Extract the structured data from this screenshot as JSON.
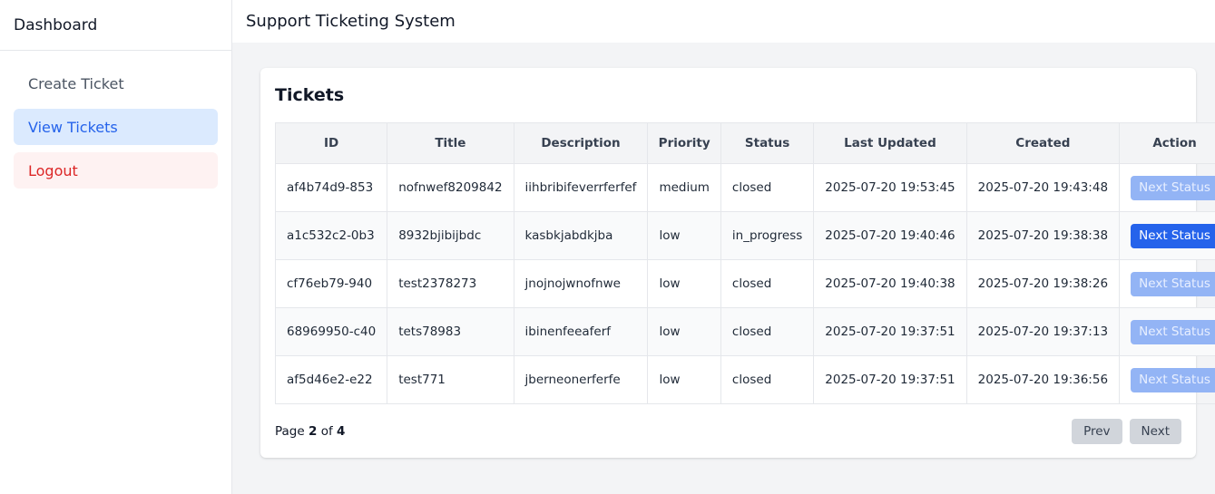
{
  "sidebar": {
    "brand": "Dashboard",
    "items": [
      {
        "label": "Create Ticket"
      },
      {
        "label": "View Tickets"
      },
      {
        "label": "Logout"
      }
    ]
  },
  "header": {
    "title": "Support Ticketing System"
  },
  "main": {
    "title": "Tickets",
    "columns": [
      "ID",
      "Title",
      "Description",
      "Priority",
      "Status",
      "Last Updated",
      "Created",
      "Action"
    ],
    "rows": [
      {
        "id": "af4b74d9-853",
        "title": "nofnwef8209842",
        "description": "iihbribifeverrferfef",
        "priority": "medium",
        "status": "closed",
        "updated": "2025-07-20 19:53:45",
        "created": "2025-07-20 19:43:48",
        "action": "Next Status",
        "action_enabled": false
      },
      {
        "id": "a1c532c2-0b3",
        "title": "8932bjibijbdc",
        "description": "kasbkjabdkjba",
        "priority": "low",
        "status": "in_progress",
        "updated": "2025-07-20 19:40:46",
        "created": "2025-07-20 19:38:38",
        "action": "Next Status",
        "action_enabled": true
      },
      {
        "id": "cf76eb79-940",
        "title": "test2378273",
        "description": "jnojnojwnofnwe",
        "priority": "low",
        "status": "closed",
        "updated": "2025-07-20 19:40:38",
        "created": "2025-07-20 19:38:26",
        "action": "Next Status",
        "action_enabled": false
      },
      {
        "id": "68969950-c40",
        "title": "tets78983",
        "description": "ibinenfeeaferf",
        "priority": "low",
        "status": "closed",
        "updated": "2025-07-20 19:37:51",
        "created": "2025-07-20 19:37:13",
        "action": "Next Status",
        "action_enabled": false
      },
      {
        "id": "af5d46e2-e22",
        "title": "test771",
        "description": "jberneonerferfe",
        "priority": "low",
        "status": "closed",
        "updated": "2025-07-20 19:37:51",
        "created": "2025-07-20 19:36:56",
        "action": "Next Status",
        "action_enabled": false
      }
    ]
  },
  "pagination": {
    "prefix": "Page",
    "current": "2",
    "separator": "of",
    "total": "4",
    "prev_label": "Prev",
    "next_label": "Next"
  },
  "colors": {
    "primary": "#2563eb",
    "primary_disabled": "#93b4f5",
    "active_nav_bg": "#dbeafe",
    "logout_bg": "#fef2f2",
    "logout_text": "#dc2626"
  }
}
